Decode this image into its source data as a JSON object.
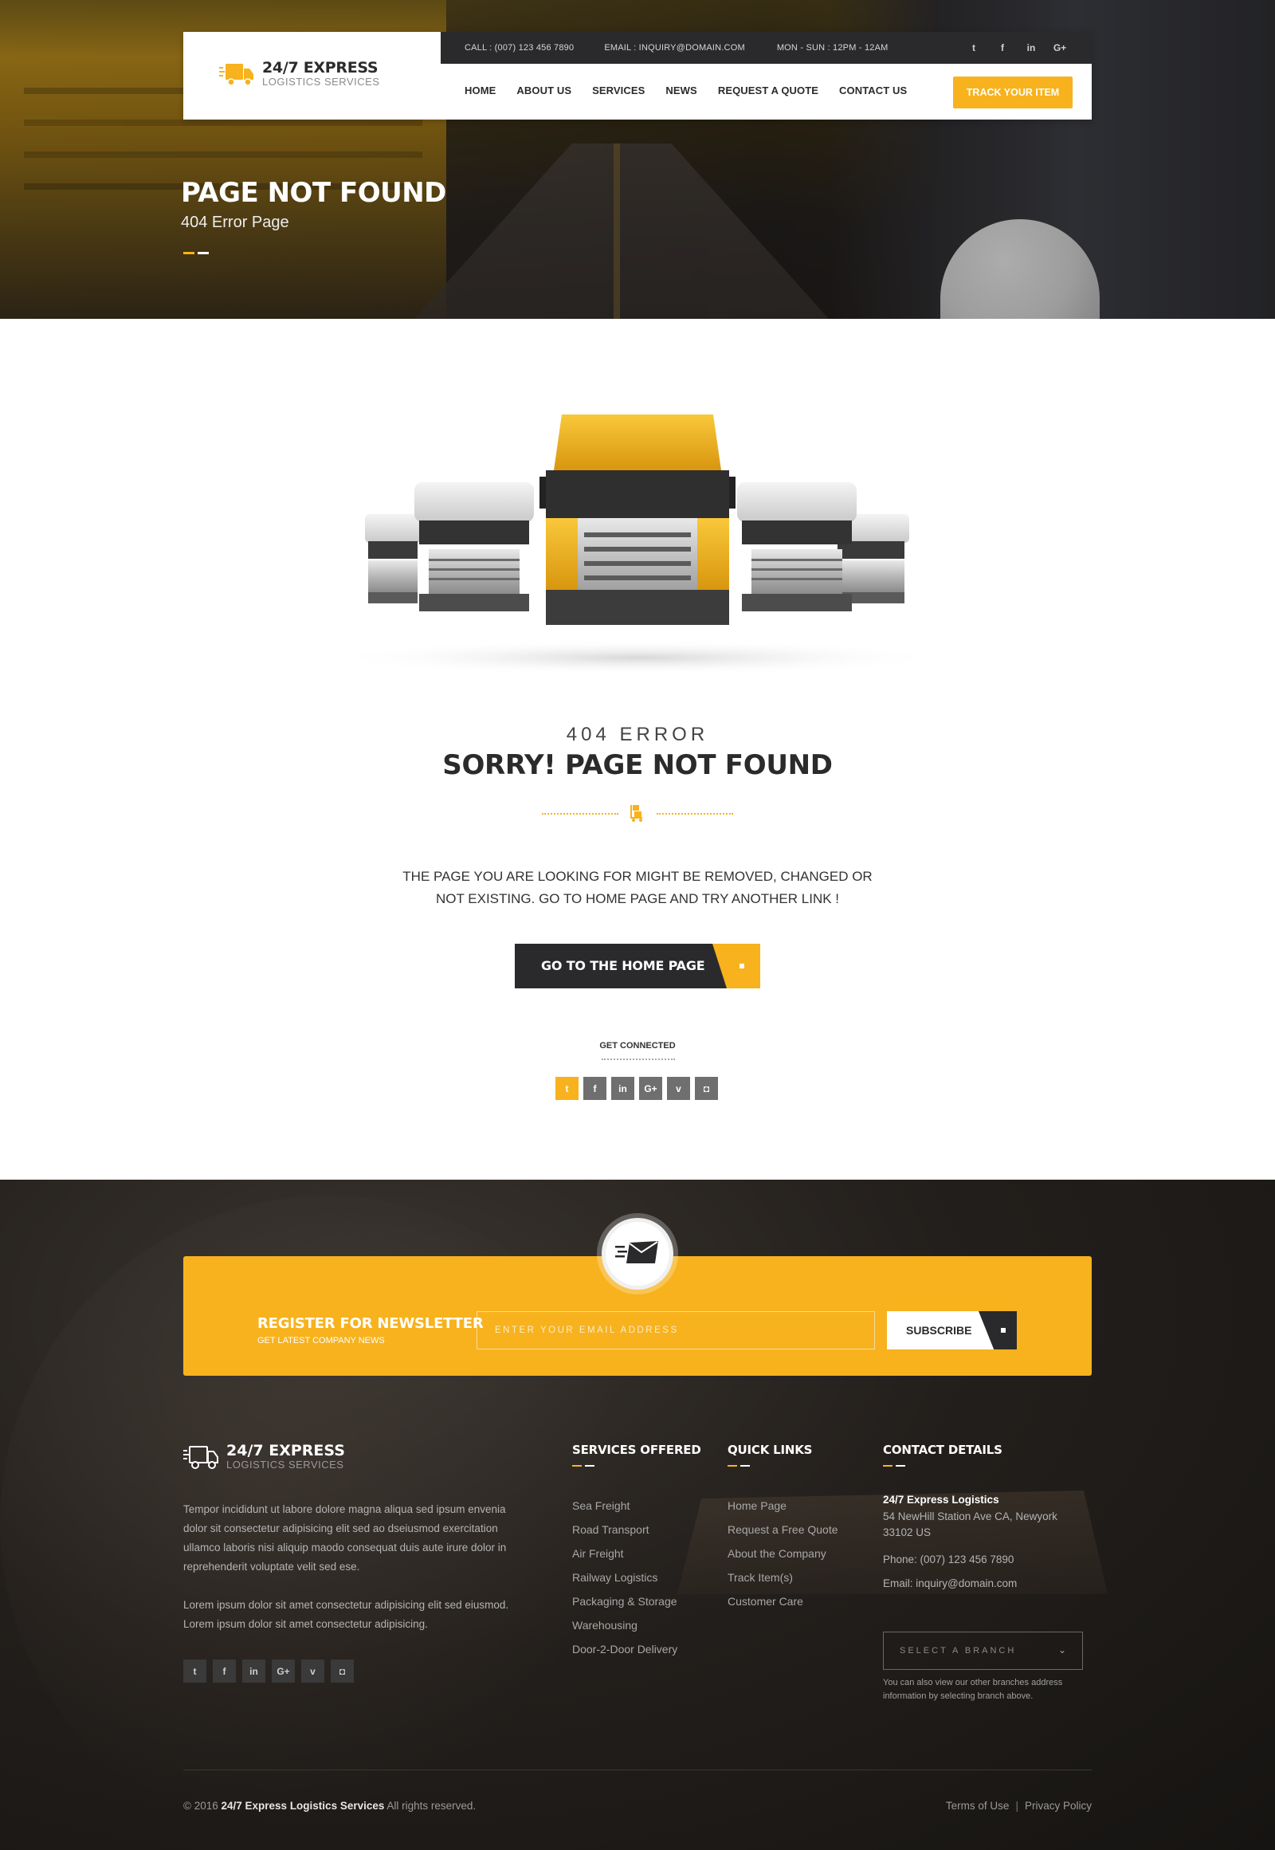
{
  "brand": {
    "name": "24/7 EXPRESS",
    "tagline": "LOGISTICS SERVICES",
    "accent": "#f7b21e",
    "dark": "#2a2a2c"
  },
  "topbar": {
    "call": "CALL : (007) 123 456 7890",
    "email": "EMAIL : INQUIRY@DOMAIN.COM",
    "hours": "MON - SUN : 12PM - 12AM",
    "socials": [
      "twitter-icon",
      "facebook-icon",
      "linkedin-icon",
      "google-plus-icon"
    ]
  },
  "nav": {
    "items": [
      "HOME",
      "ABOUT US",
      "SERVICES",
      "NEWS",
      "REQUEST A QUOTE",
      "CONTACT US"
    ],
    "cta": "TRACK YOUR ITEM"
  },
  "hero": {
    "title": "PAGE NOT FOUND",
    "subtitle": "404 Error Page"
  },
  "error": {
    "code_label": "404 ERROR",
    "heading": "SORRY!  PAGE NOT FOUND",
    "message": "THE PAGE YOU ARE LOOKING FOR MIGHT BE REMOVED, CHANGED OR NOT EXISTING. GO TO HOME PAGE AND TRY ANOTHER LINK !",
    "button": "GO TO THE HOME PAGE"
  },
  "connect": {
    "label": "GET CONNECTED",
    "socials": [
      "twitter-icon",
      "facebook-icon",
      "linkedin-icon",
      "google-plus-icon",
      "vimeo-icon",
      "instagram-icon"
    ]
  },
  "newsletter": {
    "title": "REGISTER FOR NEWSLETTER",
    "subtitle": "GET LATEST COMPANY NEWS",
    "placeholder": "ENTER YOUR EMAIL ADDRESS",
    "button": "SUBSCRIBE"
  },
  "footer": {
    "about": [
      "Tempor incididunt ut labore dolore magna aliqua sed ipsum envenia dolor sit consectetur adipisicing elit sed ao dseiusmod exercitation ullamco laboris nisi aliquip maodo consequat duis aute irure dolor in reprehenderit voluptate velit sed ese.",
      "Lorem ipsum dolor sit amet consectetur adipisicing elit sed eiusmod. Lorem ipsum dolor sit amet consectetur adipisicing."
    ],
    "services": {
      "title": "SERVICES OFFERED",
      "items": [
        "Sea Freight",
        "Road Transport",
        "Air Freight",
        "Railway Logistics",
        "Packaging & Storage",
        "Warehousing",
        "Door-2-Door Delivery"
      ]
    },
    "quick_links": {
      "title": "QUICK LINKS",
      "items": [
        "Home Page",
        "Request a Free Quote",
        "About the Company",
        "Track Item(s)",
        "Customer Care"
      ]
    },
    "contact": {
      "title": "CONTACT DETAILS",
      "name": "24/7 Express Logistics",
      "address": "54 NewHill Station Ave CA, Newyork 33102  US",
      "phone": "Phone: (007) 123 456 7890",
      "email": "Email: inquiry@domain.com",
      "branch_placeholder": "SELECT A BRANCH",
      "branch_note": "You can also view our other branches address information by selecting branch above."
    },
    "copyright_prefix": "© 2016",
    "copyright_company": "24/7 Express Logistics Services",
    "copyright_suffix": "All rights reserved.",
    "terms": "Terms of Use",
    "privacy": "Privacy Policy"
  }
}
